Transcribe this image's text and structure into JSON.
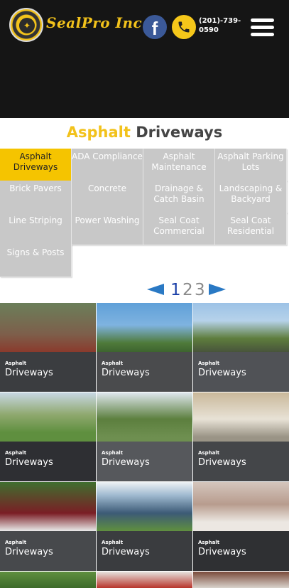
{
  "header": {
    "logo_text": "SealPro Inc",
    "phone_line1": "(201)-739-",
    "phone_line2": "0590",
    "facebook_glyph": "f"
  },
  "title": {
    "accent": "Asphalt",
    "rest": " Driveways"
  },
  "tabs": [
    {
      "label": "Asphalt Driveways",
      "active": true
    },
    {
      "label": "ADA Compliance",
      "active": false
    },
    {
      "label": "Asphalt Maintenance",
      "active": false
    },
    {
      "label": "Asphalt Parking Lots",
      "active": false
    },
    {
      "label": "Brick Pavers",
      "active": false
    },
    {
      "label": "Concrete",
      "active": false
    },
    {
      "label": "Drainage & Catch Basin",
      "active": false
    },
    {
      "label": "Landscaping & Backyard",
      "active": false
    },
    {
      "label": "Line Striping",
      "active": false
    },
    {
      "label": "Power Washing",
      "active": false
    },
    {
      "label": "Seal Coat Commercial",
      "active": false
    },
    {
      "label": "Seal Coat Residential",
      "active": false
    },
    {
      "label": "Signs & Posts",
      "active": false
    }
  ],
  "pager": {
    "pages": [
      "1",
      "2",
      "3"
    ],
    "current": "1"
  },
  "gallery": [
    {
      "small": "Asphalt",
      "big": "Driveways"
    },
    {
      "small": "Asphalt",
      "big": "Driveways"
    },
    {
      "small": "Asphalt",
      "big": "Driveways"
    },
    {
      "small": "Asphalt",
      "big": "Driveways"
    },
    {
      "small": "Asphalt",
      "big": "Driveways"
    },
    {
      "small": "Asphalt",
      "big": "Driveways"
    },
    {
      "small": "Asphalt",
      "big": "Driveways"
    },
    {
      "small": "Asphalt",
      "big": "Driveways"
    },
    {
      "small": "Asphalt",
      "big": "Driveways"
    }
  ],
  "colors": {
    "accent": "#f2c21b",
    "tab_bg": "#c8c8c8",
    "tab_active": "#f5c400",
    "arrow": "#2a79c4",
    "page_current": "#1a3fa8"
  }
}
